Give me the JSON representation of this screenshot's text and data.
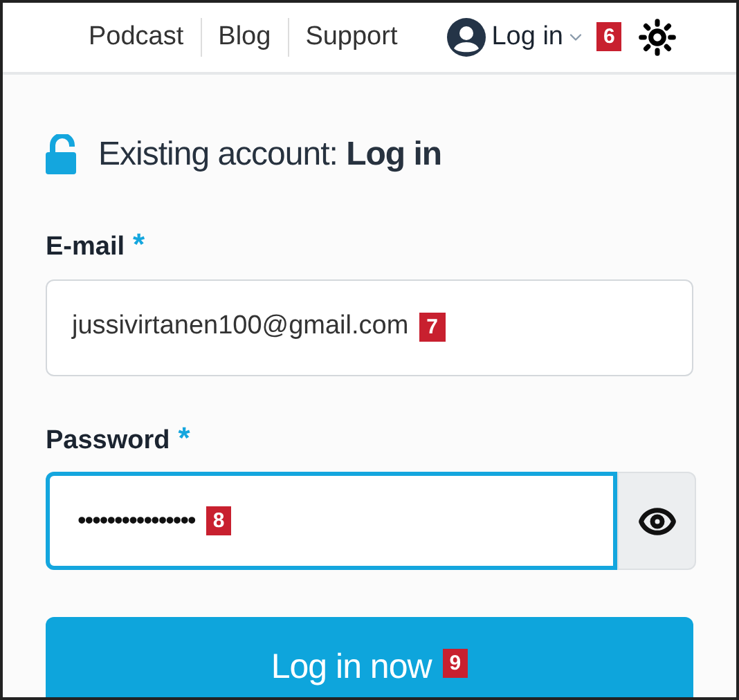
{
  "nav": {
    "links": [
      {
        "label": "Podcast"
      },
      {
        "label": "Blog"
      },
      {
        "label": "Support"
      }
    ],
    "account": {
      "label": "Log in",
      "badge": "6"
    }
  },
  "heading": {
    "text": "Existing account: **Log in**"
  },
  "email": {
    "label": "E-mail",
    "required_mark": "*",
    "value": "jussivirtanen100@gmail.com",
    "badge": "7"
  },
  "password": {
    "label": "Password",
    "required_mark": "*",
    "value": "••••••••••••••••",
    "badge": "8",
    "focused": true
  },
  "submit": {
    "label": "Log in now",
    "badge": "9"
  }
}
